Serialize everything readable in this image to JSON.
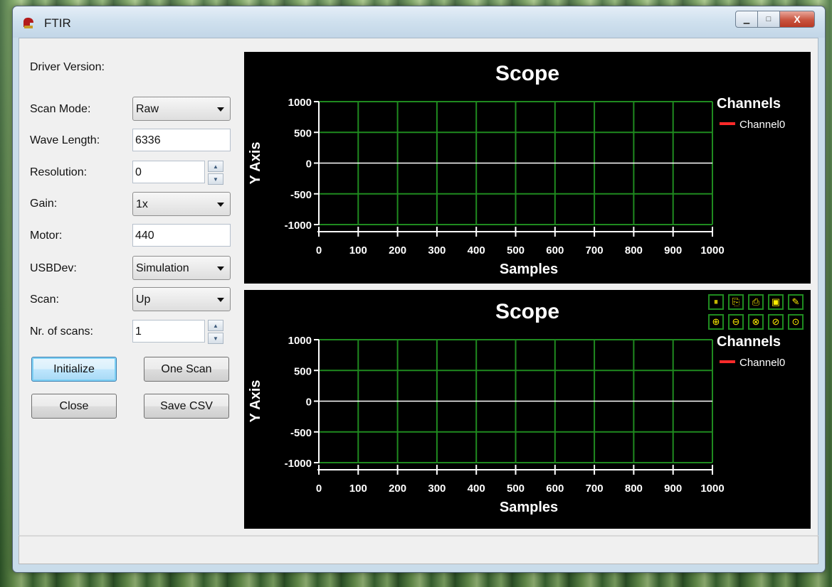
{
  "window": {
    "title": "FTIR"
  },
  "caption": {
    "minimize": "▁",
    "maximize": "□",
    "close": "X"
  },
  "form": {
    "driver_version_label": "Driver Version:",
    "scan_mode_label": "Scan Mode:",
    "scan_mode_value": "Raw",
    "wave_length_label": "Wave Length:",
    "wave_length_value": "6336",
    "resolution_label": "Resolution:",
    "resolution_value": "0",
    "gain_label": "Gain:",
    "gain_value": "1x",
    "motor_label": "Motor:",
    "motor_value": "440",
    "usbdev_label": "USBDev:",
    "usbdev_value": "Simulation",
    "scan_label": "Scan:",
    "scan_value": "Up",
    "nr_scans_label": "Nr. of scans:",
    "nr_scans_value": "1"
  },
  "buttons": {
    "initialize": "Initialize",
    "one_scan": "One Scan",
    "close": "Close",
    "save_csv": "Save CSV"
  },
  "scope_toolbar": {
    "icons": [
      "pause-icon",
      "copy-icon",
      "print-icon",
      "save-icon",
      "settings-icon",
      "zoom-in-icon",
      "zoom-out-icon",
      "zoom-reset-icon",
      "zoom-x-icon",
      "zoom-y-icon"
    ]
  },
  "colors": {
    "grid": "#1f8a1f",
    "axis": "#ffffff",
    "series": "#ff2a2a",
    "zero_line": "#ffffff",
    "toolbar_icon": "#ffee00"
  },
  "chart_data": [
    {
      "type": "line",
      "title": "Scope",
      "xlabel": "Samples",
      "ylabel": "Y Axis",
      "xlim": [
        0,
        1000
      ],
      "ylim": [
        -1000,
        1000
      ],
      "x_ticks": [
        "0",
        "100",
        "200",
        "300",
        "400",
        "500",
        "600",
        "700",
        "800",
        "900",
        "1000"
      ],
      "y_ticks": [
        "1000",
        "500",
        "0",
        "-500",
        "-1000"
      ],
      "legend_title": "Channels",
      "legend_position": "right",
      "grid": true,
      "series": [
        {
          "name": "Channel0",
          "values": []
        }
      ]
    },
    {
      "type": "line",
      "title": "Scope",
      "xlabel": "Samples",
      "ylabel": "Y Axis",
      "xlim": [
        0,
        1000
      ],
      "ylim": [
        -1000,
        1000
      ],
      "x_ticks": [
        "0",
        "100",
        "200",
        "300",
        "400",
        "500",
        "600",
        "700",
        "800",
        "900",
        "1000"
      ],
      "y_ticks": [
        "1000",
        "500",
        "0",
        "-500",
        "-1000"
      ],
      "legend_title": "Channels",
      "legend_position": "right",
      "grid": true,
      "series": [
        {
          "name": "Channel0",
          "values": []
        }
      ]
    }
  ]
}
